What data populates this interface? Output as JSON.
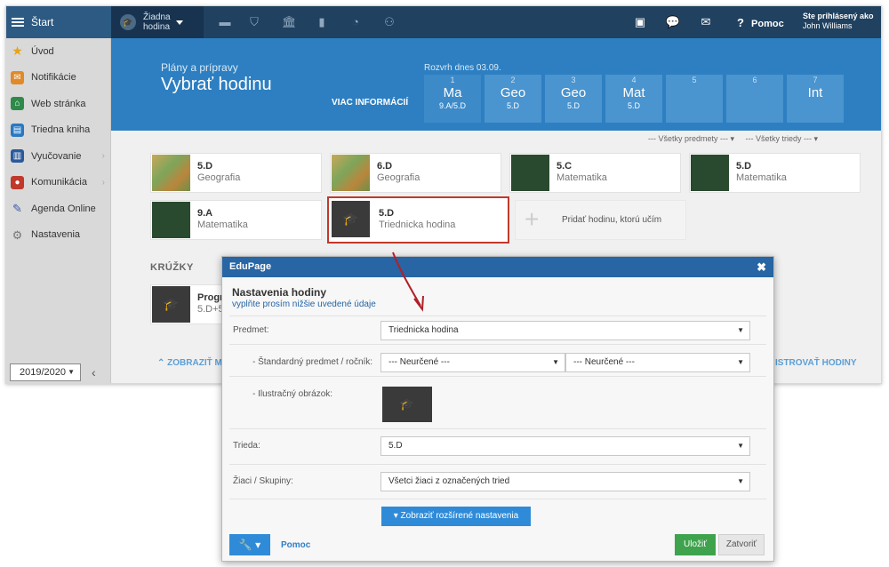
{
  "topbar": {
    "start_label": "Štart",
    "lesson_line1": "Žiadna",
    "lesson_line2": "hodina",
    "help_label": "Pomoc",
    "user_line1": "Ste prihlásený ako",
    "user_line2": "John Williams"
  },
  "sidebar": {
    "items": [
      {
        "label": "Úvod",
        "icon": "star-icon",
        "color": "#e8a317"
      },
      {
        "label": "Notifikácie",
        "icon": "envelope-icon",
        "color": "#e08a2a"
      },
      {
        "label": "Web stránka",
        "icon": "house-icon",
        "color": "#2f8a4a"
      },
      {
        "label": "Triedna kniha",
        "icon": "book-icon",
        "color": "#2a78c2"
      },
      {
        "label": "Vyučovanie",
        "icon": "open-book-icon",
        "color": "#2a5a9a"
      },
      {
        "label": "Komunikácia",
        "icon": "chat-icon",
        "color": "#c0392b"
      },
      {
        "label": "Agenda Online",
        "icon": "pen-icon",
        "color": "#3a5aa8"
      },
      {
        "label": "Nastavenia",
        "icon": "gear-icon",
        "color": "#777777"
      }
    ],
    "year": "2019/2020"
  },
  "header": {
    "subtitle": "Plány a prípravy",
    "title": "Vybrať hodinu",
    "more_info": "VIAC INFORMÁCIÍ",
    "schedule_label": "Rozvrh dnes 03.09.",
    "slots": [
      {
        "num": "1",
        "subject": "Ma",
        "class": "9.A/5.D"
      },
      {
        "num": "2",
        "subject": "Geo",
        "class": "5.D"
      },
      {
        "num": "3",
        "subject": "Geo",
        "class": "5.D"
      },
      {
        "num": "4",
        "subject": "Mat",
        "class": "5.D"
      },
      {
        "num": "5",
        "subject": "",
        "class": ""
      },
      {
        "num": "6",
        "subject": "",
        "class": ""
      },
      {
        "num": "7",
        "subject": "Int",
        "class": ""
      }
    ]
  },
  "filters": {
    "subjects": "--- Všetky predmety ---  ▾",
    "classes": "--- Všetky triedy ---  ▾"
  },
  "lessons": [
    {
      "name": "5.D",
      "subject": "Geografia",
      "thumb": "geo"
    },
    {
      "name": "6.D",
      "subject": "Geografia",
      "thumb": "geo"
    },
    {
      "name": "5.C",
      "subject": "Matematika",
      "thumb": "mat"
    },
    {
      "name": "5.D",
      "subject": "Matematika",
      "thumb": "mat"
    },
    {
      "name": "9.A",
      "subject": "Matematika",
      "thumb": "mat"
    },
    {
      "name": "5.D",
      "subject": "Triednicka hodina",
      "thumb": "dark"
    }
  ],
  "add_lesson": "Pridať hodinu, ktorú učím",
  "kruzky": {
    "heading": "KRÚŽKY",
    "card_name": "Progr",
    "card_sub": "5.D+5"
  },
  "bottom_links": {
    "left": "⌃ ZOBRAZIŤ M",
    "right": "ISTROVAŤ HODINY"
  },
  "dialog": {
    "header": "EduPage",
    "title": "Nastavenia hodiny",
    "subtitle": "vyplňte prosím nižšie uvedené údaje",
    "fields": {
      "predmet_label": "Predmet:",
      "predmet_value": "Triednicka hodina",
      "standard_label": "- Štandardný predmet / ročník:",
      "standard_value1": "--- Neurčené ---",
      "standard_value2": "--- Neurčené ---",
      "illus_label": "- Ilustračný obrázok:",
      "trieda_label": "Trieda:",
      "trieda_value": "5.D",
      "ziaci_label": "Žiaci / Skupiny:",
      "ziaci_value": "Všetci žiaci z označených tried"
    },
    "extended_button": "▾  Zobraziť rozšírené nastavenia",
    "help": "Pomoc",
    "save": "Uložiť",
    "close": "Zatvoriť"
  }
}
